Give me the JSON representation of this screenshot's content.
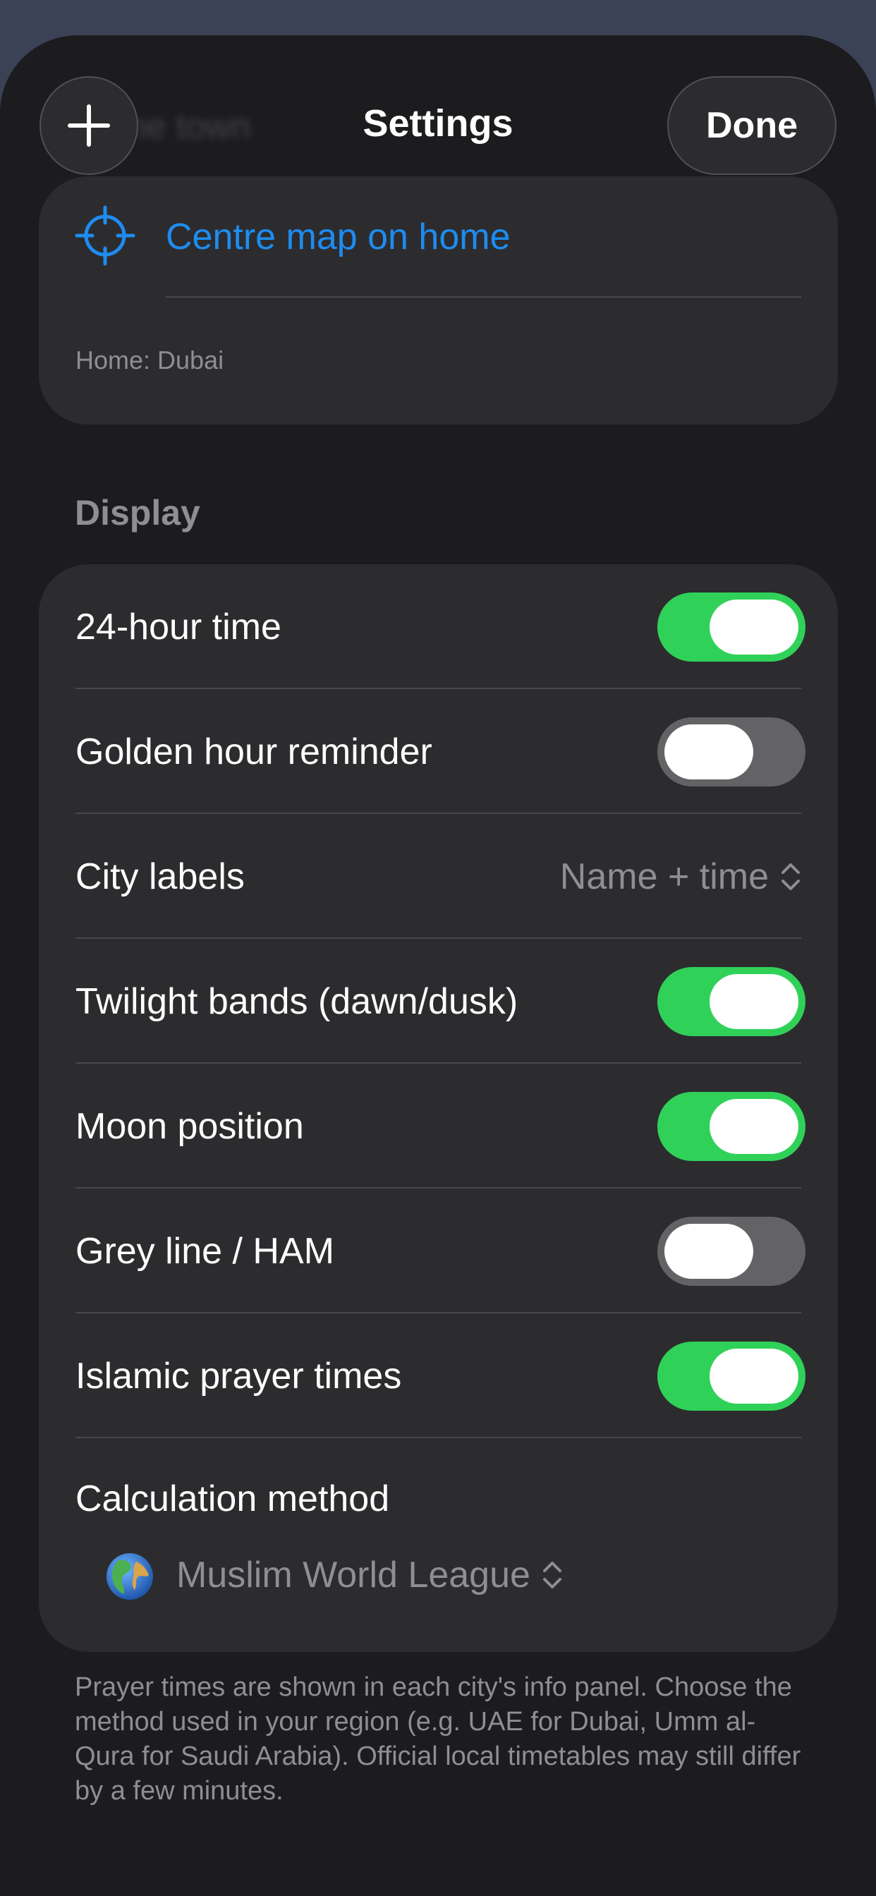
{
  "header": {
    "ghost_text": "ne town",
    "title": "Settings",
    "done_label": "Done"
  },
  "home": {
    "centre_label": "Centre map on home",
    "caption": "Home: Dubai"
  },
  "display": {
    "section_title": "Display",
    "rows": [
      {
        "label": "24-hour time",
        "type": "toggle",
        "on": true
      },
      {
        "label": "Golden hour reminder",
        "type": "toggle",
        "on": false
      },
      {
        "label": "City labels",
        "type": "picker",
        "value": "Name + time"
      },
      {
        "label": "Twilight bands (dawn/dusk)",
        "type": "toggle",
        "on": true
      },
      {
        "label": "Moon position",
        "type": "toggle",
        "on": true
      },
      {
        "label": "Grey line / HAM",
        "type": "toggle",
        "on": false
      },
      {
        "label": "Islamic prayer times",
        "type": "toggle",
        "on": true
      }
    ],
    "calculation": {
      "label": "Calculation method",
      "value": "Muslim World League"
    }
  },
  "footer": {
    "text": "Prayer times are shown in each city's info panel. Choose the method used in your region (e.g. UAE for Dubai, Umm al-Qura for Saudi Arabia). Official local timetables may still differ by a few minutes."
  },
  "colors": {
    "accent": "#1e8cf0",
    "toggle_on": "#30d158",
    "toggle_off": "#636366",
    "card": "#2c2c2e",
    "background": "#1c1c1e"
  }
}
